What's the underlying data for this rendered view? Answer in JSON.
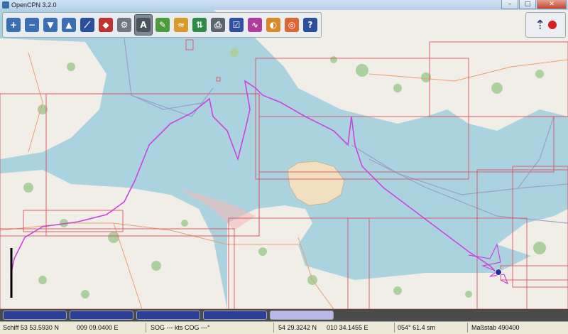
{
  "window": {
    "title": "OpenCPN 3.2.0",
    "min": "–",
    "max": "□",
    "close": "✕"
  },
  "toolbar": {
    "buttons": [
      {
        "name": "zoom-in-button",
        "glyph": "+",
        "color": "#3b6fb5"
      },
      {
        "name": "zoom-out-button",
        "glyph": "−",
        "color": "#3b6fb5"
      },
      {
        "name": "scale-in-button",
        "glyph": "▼",
        "color": "#3b6fb5"
      },
      {
        "name": "scale-out-button",
        "glyph": "▲",
        "color": "#3b6fb5"
      },
      {
        "name": "route-button",
        "glyph": "⟋",
        "color": "#2a4f9e"
      },
      {
        "name": "mob-button",
        "glyph": "◆",
        "color": "#c23030"
      },
      {
        "name": "settings-button",
        "glyph": "⚙",
        "color": "#6f7880"
      },
      {
        "name": "text-button",
        "glyph": "A",
        "color": "#4a545e",
        "active": true
      },
      {
        "name": "measure-button",
        "glyph": "✎",
        "color": "#4d9b3a"
      },
      {
        "name": "tides-button",
        "glyph": "≈",
        "color": "#d99a27"
      },
      {
        "name": "currents-button",
        "glyph": "⇅",
        "color": "#2d8a47"
      },
      {
        "name": "print-button",
        "glyph": "⎙",
        "color": "#5a6570"
      },
      {
        "name": "route-manager-button",
        "glyph": "☑",
        "color": "#3050a8"
      },
      {
        "name": "track-button",
        "glyph": "∿",
        "color": "#b23c9c"
      },
      {
        "name": "color-scheme-button",
        "glyph": "◐",
        "color": "#d9892a"
      },
      {
        "name": "lifebuoy-button",
        "glyph": "◎",
        "color": "#e06530"
      },
      {
        "name": "help-button",
        "glyph": "?",
        "color": "#2a4f9e"
      }
    ]
  },
  "status": {
    "ship": "Schiff 53 53.5930 N",
    "ship_lon": "009 09.0400 E",
    "sog_cog": "SOG --- kts  COG ---°",
    "cursor_lat": "54 29.3242 N",
    "cursor_lon": "010 34.1455 E",
    "bearing": "054°  61.4 sm",
    "scale": "Maßstab 490400"
  },
  "piano": {
    "keys": [
      {
        "active": false
      },
      {
        "active": false
      },
      {
        "active": false
      },
      {
        "active": false
      },
      {
        "active": true
      }
    ]
  },
  "colors": {
    "sea": "#aad3df",
    "land": "#f1eee8",
    "forest": "#add19e",
    "track": "#cc44dd",
    "chart_border": "#e05060"
  }
}
